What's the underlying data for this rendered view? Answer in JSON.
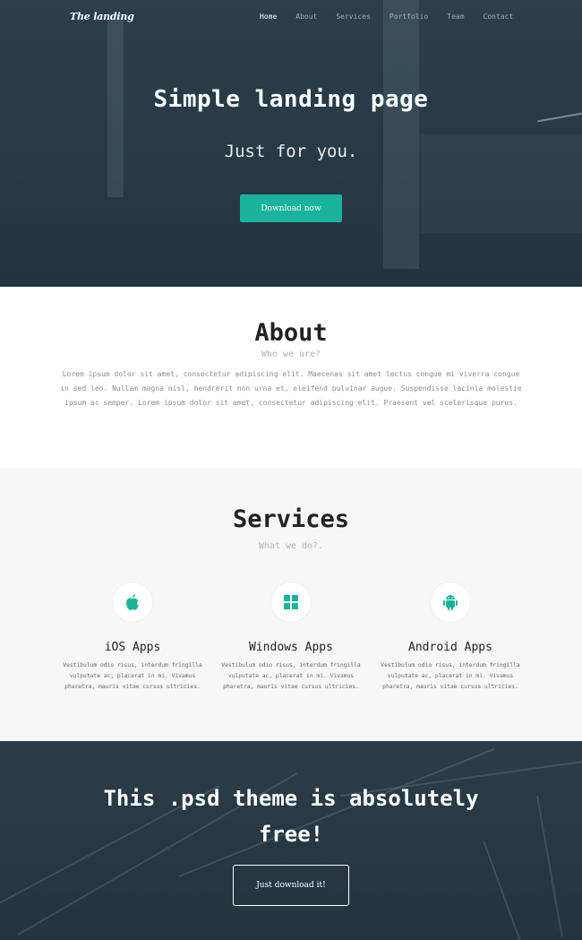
{
  "nav": {
    "logo": "The landing",
    "links": [
      "Home",
      "About",
      "Services",
      "Portfolio",
      "Team",
      "Contact"
    ]
  },
  "hero": {
    "title": "Simple landing page",
    "subtitle": "Just for you.",
    "button": "Download now"
  },
  "about": {
    "title": "About",
    "subtitle": "Who we are?",
    "text": "Lorem ipsum dolor sit amet, consectetur adipiscing elit. Maecenas sit amet lectus congue mi viverra congue in sed leo. Nullam magna nisl, hendrerit non urna et, eleifend pulvinar augue. Suspendisse lacinia molestie ipsum ac semper. Lorem ipsum dolor sit amet, consectetur adipiscing elit. Praesent vel scelerisque purus."
  },
  "services": {
    "title": "Services",
    "subtitle": "What we do?.",
    "items": [
      {
        "name": "iOS Apps",
        "icon": "apple-icon",
        "desc": "Vestibulum odio risus, interdum fringilla vulputate ac, placerat in mi. Vivamus pharetra, mauris vitae cursus ultricies."
      },
      {
        "name": "Windows Apps",
        "icon": "windows-icon",
        "desc": "Vestibulum odio risus, interdum fringilla vulputate ac, placerat in mi. Vivamus pharetra, mauris vitae cursus ultricies."
      },
      {
        "name": "Android Apps",
        "icon": "android-icon",
        "desc": "Vestibulum odio risus, interdum fringilla vulputate ac, placerat in mi. Vivamus pharetra, mauris vitae cursus ultricies."
      }
    ]
  },
  "cta": {
    "title": "This .psd theme is absolutely free!",
    "button": "Just download it!"
  },
  "colors": {
    "accent": "#18b39a",
    "hero_bg": "#263945",
    "services_bg": "#f7f7f8"
  }
}
